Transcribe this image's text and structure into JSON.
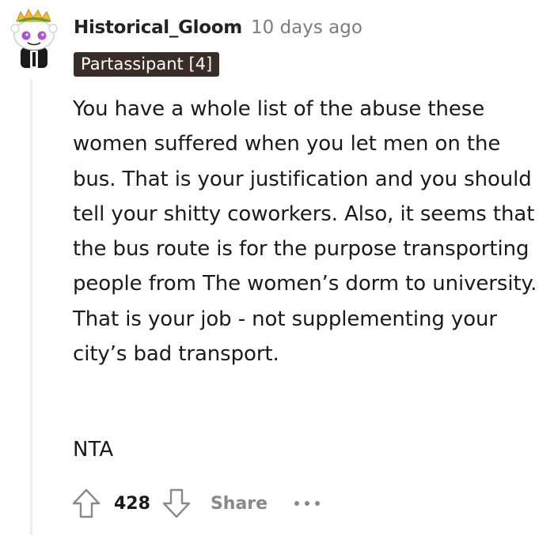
{
  "comment": {
    "author": "Historical_Gloom",
    "separator": "·",
    "timestamp": "10 days ago",
    "flair": "Partassipant [4]",
    "body_paragraphs": [
      "You have a whole list of the abuse these women suffered when you let men on the bus. That is your justification and you should tell your shitty coworkers. Also, it seems that the bus route is for the purpose transporting people from The women’s dorm to university. That is your job - not supplementing your city’s bad transport."
    ],
    "verdict": "NTA",
    "score": "428",
    "share_label": "Share"
  },
  "icons": {
    "avatar": "snoo-avatar-icon",
    "upvote": "upvote-arrow-icon",
    "downvote": "downvote-arrow-icon",
    "more": "more-options-icon"
  },
  "colors": {
    "flair_background": "#3a2d25",
    "muted_text": "#7c7c7c",
    "thread_line": "#edeff1",
    "avatar_accent": "#b14fd8"
  }
}
